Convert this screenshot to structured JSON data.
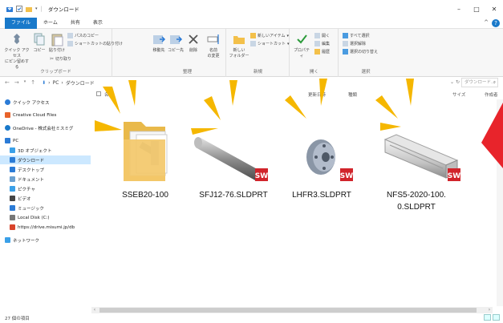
{
  "window": {
    "title": "ダウンロード",
    "controls": {
      "minimize": "–",
      "maximize": "□",
      "close": "✕"
    }
  },
  "ribbon_tabs": [
    {
      "label": "ファイル"
    },
    {
      "label": "ホーム"
    },
    {
      "label": "共有"
    },
    {
      "label": "表示"
    }
  ],
  "ribbon": {
    "clipboard": {
      "quick_access": "クイック アクセス\nにピン留めする",
      "copy": "コピー",
      "paste": "貼り付け",
      "copy_path": "パスのコピー",
      "paste_shortcut": "ショートカットの貼り付け",
      "cut": "切り取り",
      "label": "クリップボード"
    },
    "organize": {
      "move_to": "移動先",
      "copy_to": "コピー先",
      "delete": "削除",
      "rename": "名前\nの変更",
      "label": "整理"
    },
    "new": {
      "new_folder": "新しい\nフォルダー",
      "new_item": "新しいアイテム",
      "shortcut": "ショートカット",
      "label": "新規"
    },
    "open": {
      "properties": "プロパティ",
      "open": "開く",
      "edit": "編集",
      "history": "履歴",
      "label": "開く"
    },
    "select": {
      "select_all": "すべて選択",
      "select_none": "選択解除",
      "invert": "選択の切り替え",
      "label": "選択"
    }
  },
  "address": {
    "crumbs": [
      "PC",
      "ダウンロード"
    ],
    "search_placeholder": "ダウンロード..."
  },
  "nav_pane": {
    "items": [
      {
        "label": "クイック アクセス",
        "icon": "star-icon",
        "color": "#2b7bd6"
      },
      {
        "label": "Creative Cloud Files",
        "icon": "cc-icon",
        "color": "#e8632a"
      },
      {
        "label": "OneDrive - 株式会社ミスミグ",
        "icon": "cloud-icon",
        "color": "#1979ca"
      },
      {
        "label": "PC",
        "icon": "pc-icon",
        "color": "#2b7bd6"
      },
      {
        "label": "3D オブジェクト",
        "icon": "cube-icon",
        "color": "#3aa0e8"
      },
      {
        "label": "ダウンロード",
        "icon": "download-icon",
        "color": "#2b7bd6"
      },
      {
        "label": "デスクトップ",
        "icon": "desktop-icon",
        "color": "#2b7bd6"
      },
      {
        "label": "ドキュメント",
        "icon": "document-icon",
        "color": "#6aa0d0"
      },
      {
        "label": "ピクチャ",
        "icon": "picture-icon",
        "color": "#3aa0e8"
      },
      {
        "label": "ビデオ",
        "icon": "video-icon",
        "color": "#444"
      },
      {
        "label": "ミュージック",
        "icon": "music-icon",
        "color": "#2b7bd6"
      },
      {
        "label": "Local Disk (C:)",
        "icon": "disk-icon",
        "color": "#777"
      },
      {
        "label": "https://drive.misumi.jp/db",
        "icon": "network-drive-icon",
        "color": "#d9442b"
      },
      {
        "label": "ネットワーク",
        "icon": "network-icon",
        "color": "#3aa0e8"
      }
    ],
    "selected_index": 5
  },
  "columns": {
    "name": "名前",
    "date": "更新日時",
    "type": "種類",
    "size": "サイズ",
    "author": "作成者"
  },
  "files": [
    {
      "label": "SSEB20-100",
      "kind": "folder"
    },
    {
      "label": "SFJ12-76.SLDPRT",
      "kind": "shaft",
      "badge": "SW"
    },
    {
      "label": "LHFR3.SLDPRT",
      "kind": "flange",
      "badge": "SW"
    },
    {
      "label": "NFS5-2020-100.\n0.SLDPRT",
      "kind": "extrusion",
      "badge": "SW"
    }
  ],
  "status": {
    "item_count": "27 個の項目"
  },
  "colors": {
    "accent": "#1979ca",
    "selection": "#cce8ff",
    "highlight_ray": "#f5b700",
    "arrow_red": "#e8242b",
    "sw_badge": "#d1242b"
  }
}
